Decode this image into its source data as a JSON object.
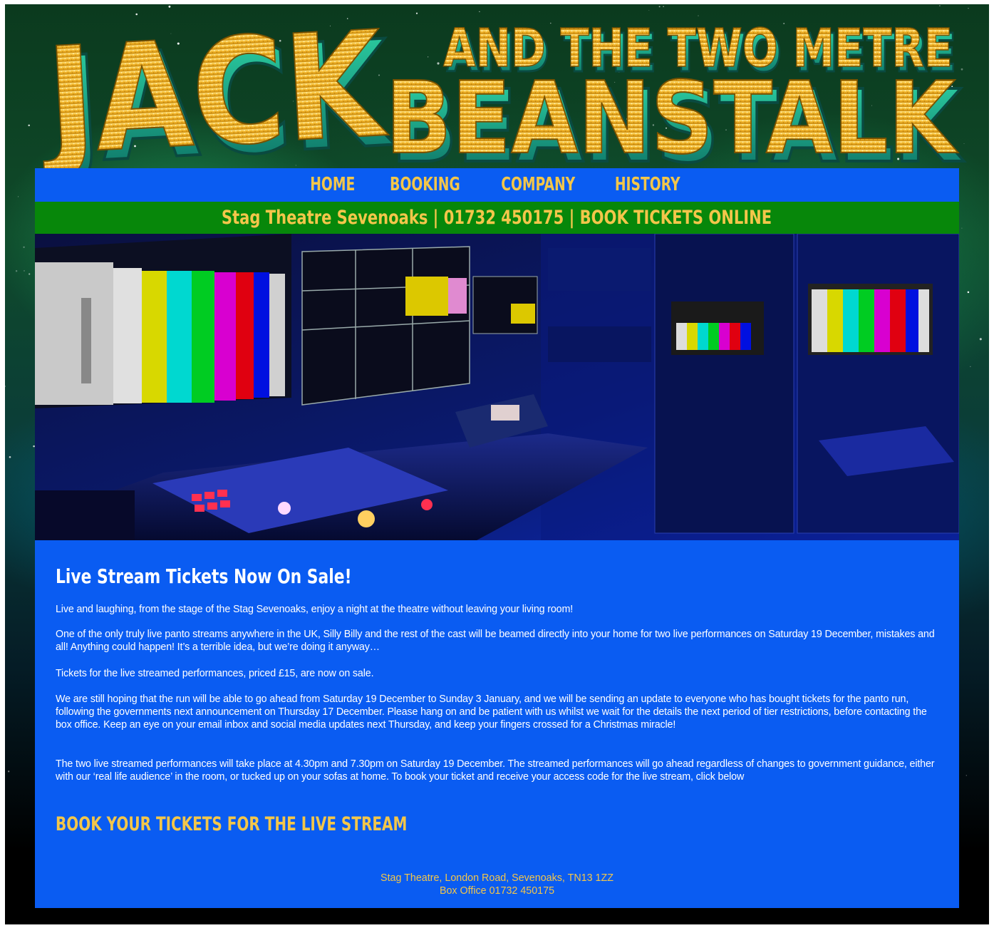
{
  "header": {
    "title_word1": "JACK",
    "title_line1": "AND THE TWO METRE",
    "title_line2": "BEANSTALK"
  },
  "nav": {
    "items": [
      {
        "label": "HOME"
      },
      {
        "label": "BOOKING"
      },
      {
        "label": "COMPANY"
      },
      {
        "label": "HISTORY"
      }
    ]
  },
  "info_bar": {
    "text": "Stag Theatre Sevenoaks | 01732 450175 | BOOK TICKETS ONLINE"
  },
  "content": {
    "heading": "Live Stream Tickets Now On Sale!",
    "paragraphs": [
      "Live and laughing, from the stage of the Stag Sevenoaks, enjoy a night at the theatre without leaving your living room!",
      "One of the only truly live panto streams anywhere in the UK, Silly Billy and the rest of the cast will be beamed directly into your home for two live performances on Saturday 19 December, mistakes and all! Anything could happen! It’s a terrible idea, but we’re doing it anyway…",
      "Tickets for the live streamed performances, priced £15, are now on sale.",
      "We are still hoping that the run will be able to go ahead from Saturday 19 December to Sunday 3 January, and we will be sending an update to everyone who has bought tickets for the panto run, following the governments next announcement on Thursday 17 December. Please hang on and be patient with us whilst we wait for the details the next period of tier restrictions, before contacting the box office. Keep an eye on your email inbox and social media updates next Thursday, and keep your fingers crossed for a Christmas miracle!",
      "The two live streamed performances will take place at 4.30pm and 7.30pm on Saturday 19 December. The streamed performances will go ahead regardless of changes to government guidance, either with our ‘real life audience’ in the room, or tucked up on your sofas at home. To book your ticket and receive your access code for the live stream, click below"
    ],
    "book_link": "BOOK YOUR TICKETS FOR THE LIVE STREAM"
  },
  "footer": {
    "address": "Stag Theatre, London Road, Sevenoaks, TN13 1ZZ",
    "box_office": "Box Office 01732 450175"
  },
  "colors": {
    "panel_blue": "#0a5cf2",
    "info_green": "#07870a",
    "accent_gold": "#f3c64a"
  }
}
